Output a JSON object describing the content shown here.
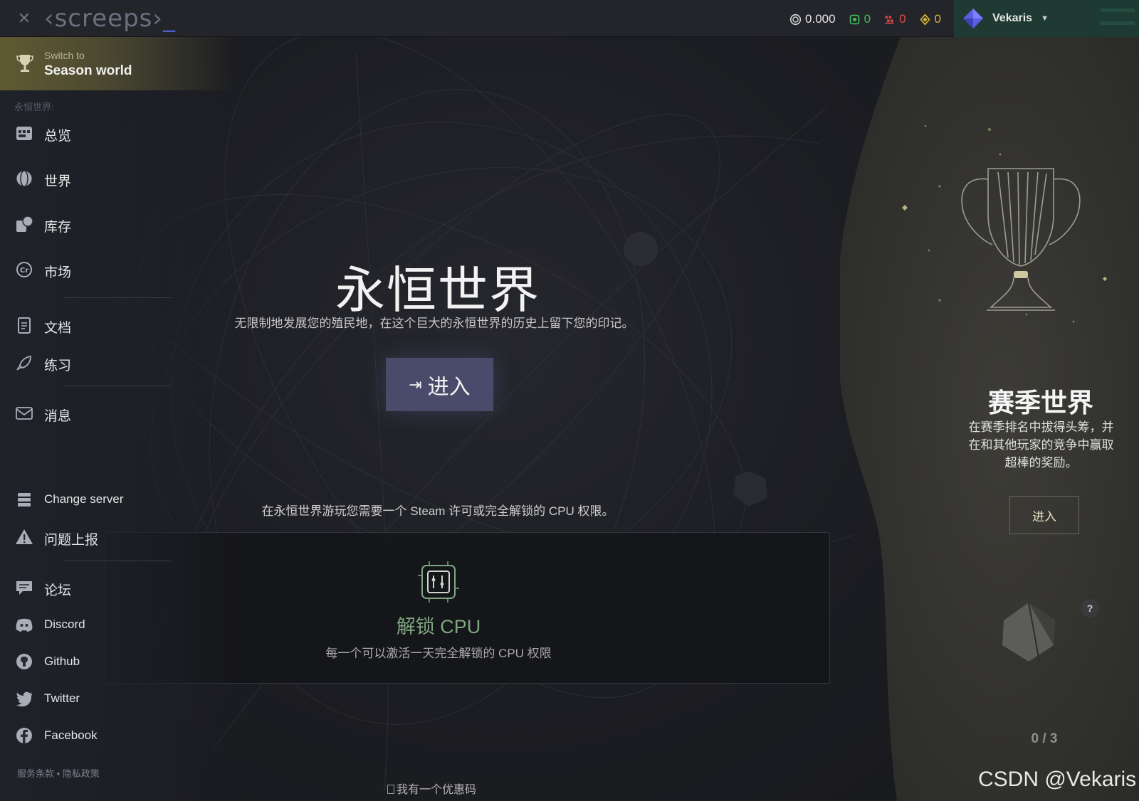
{
  "topbar": {
    "logo": "‹screeps›",
    "logo_underscore": "_",
    "resources": {
      "credits": "0.000",
      "cpu_unlock": "0",
      "pixel": "0",
      "access_key": "0"
    },
    "username": "Vekaris"
  },
  "sidebar": {
    "season_switch_small": "Switch to",
    "season_switch_big": "Season world",
    "section_title": "永恒世界:",
    "items": [
      {
        "label": "总览"
      },
      {
        "label": "世界"
      },
      {
        "label": "库存"
      },
      {
        "label": "市场"
      },
      {
        "label": "文档"
      },
      {
        "label": "练习"
      },
      {
        "label": "消息"
      },
      {
        "label": "Change server"
      },
      {
        "label": "问题上报"
      },
      {
        "label": "论坛"
      },
      {
        "label": "Discord"
      },
      {
        "label": "Github"
      },
      {
        "label": "Twitter"
      },
      {
        "label": "Facebook"
      }
    ],
    "footer_terms": "服务条款",
    "footer_sep": " • ",
    "footer_privacy": "隐私政策"
  },
  "main": {
    "title": "永恒世界",
    "subtitle": "无限制地发展您的殖民地，在这个巨大的永恒世界的历史上留下您的印记。",
    "enter_label": "进入",
    "steam_note": "在永恒世界游玩您需要一个 Steam 许可或完全解锁的 CPU 权限。",
    "cpu_title": "解锁 CPU",
    "cpu_desc": "每一个可以激活一天完全解锁的 CPU 权限",
    "promo": "我有一个优惠码"
  },
  "season": {
    "title": "赛季世界",
    "desc": "在赛季排名中拔得头筹，并在和其他玩家的竞争中赢取超棒的奖励。",
    "enter_label": "进入",
    "help": "?",
    "count": "0 / 3"
  },
  "watermark": "CSDN @Vekaris",
  "colors": {
    "accent": "#4a4b6b",
    "cpu_green": "#7fa682",
    "credit": "#d8d8d8",
    "cpu_unlock": "#3fbf5a",
    "pixel": "#e0464a",
    "access_key": "#d8b535"
  }
}
